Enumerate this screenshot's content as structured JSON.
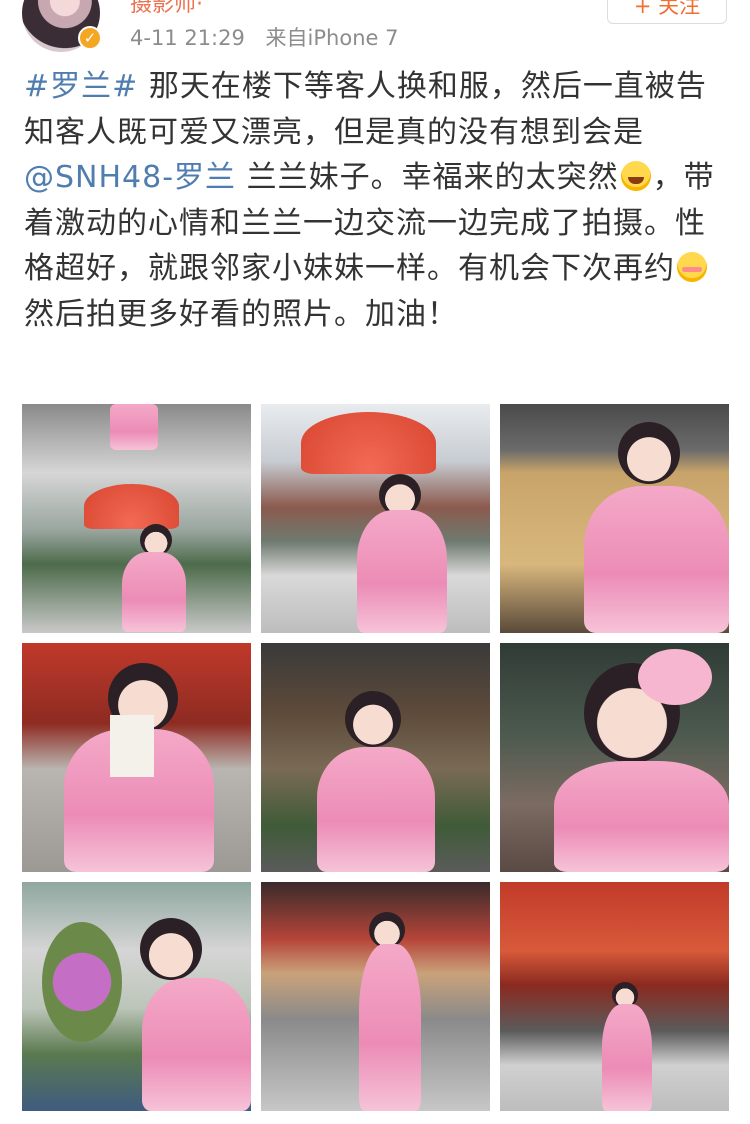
{
  "post": {
    "username": "摄影师·",
    "time": "4-11 21:29",
    "source": "来自iPhone 7",
    "follow_label": "+ 关注",
    "text": {
      "topic": "#罗兰#",
      "part1": " 那天在楼下等客人换和服，然后一直被告知客人既可爱又漂亮，但是真的没有想到会是",
      "mention": "@SNH48-罗兰",
      "part2": " 兰兰妹子。幸福来的太突然",
      "part3": "，带着激动的心情和兰兰一边交流一边完成了拍摄。性格超好，就跟邻家小妹妹一样。有机会下次再约",
      "part4": "然后拍更多好看的照片。加油！"
    }
  },
  "photos": [
    {
      "id": "photo-1",
      "desc": "kimono-umbrella-steps"
    },
    {
      "id": "photo-2",
      "desc": "kimono-umbrella-temple"
    },
    {
      "id": "photo-3",
      "desc": "kimono-drawers"
    },
    {
      "id": "photo-4",
      "desc": "kimono-fortune-paper"
    },
    {
      "id": "photo-5",
      "desc": "kimono-eating-snack"
    },
    {
      "id": "photo-6",
      "desc": "kimono-eating-closeup"
    },
    {
      "id": "photo-7",
      "desc": "kimono-flowers"
    },
    {
      "id": "photo-8",
      "desc": "kimono-street"
    },
    {
      "id": "photo-9",
      "desc": "kimono-red-temple"
    }
  ],
  "colors": {
    "link": "#507daf",
    "username": "#eb7350",
    "follow": "#f26d31",
    "meta": "#8c8c8c"
  }
}
